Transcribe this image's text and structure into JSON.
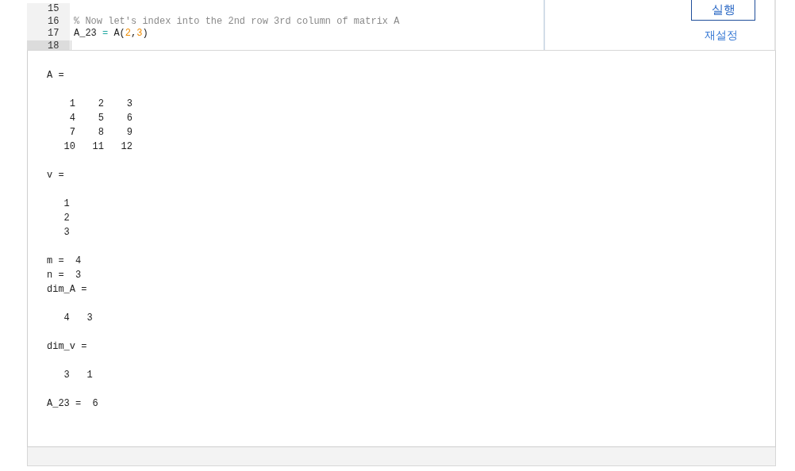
{
  "editor": {
    "lines": [
      {
        "number": "15",
        "current": false
      },
      {
        "number": "16",
        "current": false,
        "tokens": [
          {
            "text": "% Now let's index into the 2nd row 3rd column of matrix A",
            "kind": "comment"
          }
        ]
      },
      {
        "number": "17",
        "current": false,
        "tokens": [
          {
            "text": "A_23 ",
            "kind": "plain"
          },
          {
            "text": "=",
            "kind": "operator"
          },
          {
            "text": " A(",
            "kind": "plain"
          },
          {
            "text": "2",
            "kind": "number"
          },
          {
            "text": ",",
            "kind": "plain"
          },
          {
            "text": "3",
            "kind": "number"
          },
          {
            "text": ")",
            "kind": "plain"
          }
        ]
      },
      {
        "number": "18",
        "current": true
      }
    ]
  },
  "actions": {
    "run_button": "실행",
    "reset_link": "재설정"
  },
  "output": [
    [
      "A ="
    ],
    [
      "    1    2    3",
      "    4    5    6",
      "    7    8    9",
      "   10   11   12"
    ],
    [
      "v ="
    ],
    [
      "   1",
      "   2",
      "   3"
    ],
    [
      "m =  4",
      "n =  3",
      "dim_A ="
    ],
    [
      "   4   3"
    ],
    [
      "dim_v ="
    ],
    [
      "   3   1"
    ],
    [
      "A_23 =  6"
    ]
  ]
}
